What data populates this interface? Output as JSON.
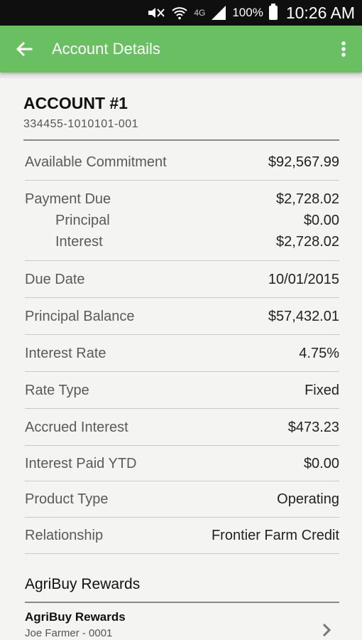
{
  "status_bar": {
    "network": "4G",
    "battery": "100%",
    "time": "10:26 AM",
    "icons": [
      "mute-icon",
      "wifi-icon",
      "signal-icon",
      "battery-icon"
    ]
  },
  "app_bar": {
    "title": "Account Details",
    "back_icon": "arrow-back-icon",
    "menu_icon": "more-vert-icon",
    "color": "#6abf63"
  },
  "account": {
    "title": "ACCOUNT #1",
    "number": "334455-1010101-001"
  },
  "details": [
    {
      "label": "Available Commitment",
      "value": "$92,567.99"
    },
    {
      "label": "Payment Due",
      "value": "$2,728.02",
      "sub": [
        {
          "label": "Principal",
          "value": "$0.00"
        },
        {
          "label": "Interest",
          "value": "$2,728.02"
        }
      ]
    },
    {
      "label": "Due Date",
      "value": "10/01/2015"
    },
    {
      "label": "Principal Balance",
      "value": "$57,432.01"
    },
    {
      "label": "Interest Rate",
      "value": "4.75%"
    },
    {
      "label": "Rate Type",
      "value": "Fixed"
    },
    {
      "label": "Accrued Interest",
      "value": "$473.23"
    },
    {
      "label": "Interest Paid YTD",
      "value": "$0.00"
    },
    {
      "label": "Product Type",
      "value": "Operating"
    },
    {
      "label": "Relationship",
      "value": "Frontier Farm Credit"
    }
  ],
  "rewards": {
    "heading": "AgriBuy Rewards",
    "item": {
      "title": "AgriBuy Rewards",
      "subtitle": "Joe Farmer - 0001"
    }
  }
}
